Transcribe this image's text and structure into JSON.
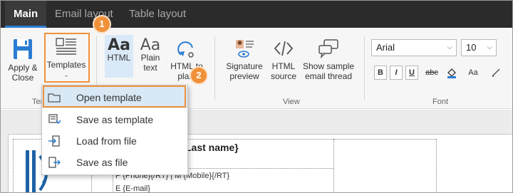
{
  "tabs": [
    {
      "label": "Main",
      "active": true
    },
    {
      "label": "Email layout",
      "active": false
    },
    {
      "label": "Table layout",
      "active": false
    }
  ],
  "ribbon": {
    "apply_close": "Apply & Close",
    "apply_close_l1": "Apply &",
    "apply_close_l2": "Close",
    "templates": "Templates",
    "templates_group_label": "Ten",
    "html_label": "HTML",
    "plain_text_l1": "Plain",
    "plain_text_l2": "text",
    "html_to_plain_l1": "HTML to",
    "html_to_plain_l2": "plain",
    "signature_preview_l1": "Signature",
    "signature_preview_l2": "preview",
    "html_source_l1": "HTML",
    "html_source_l2": "source",
    "show_sample_l1": "Show sample",
    "show_sample_l2": "email thread",
    "view_group_label": "View",
    "font_group_label": "Font",
    "font_family": "Arial",
    "font_size": "10",
    "bold": "B",
    "italic": "I",
    "underline": "U",
    "strike": "abc",
    "case": "Aa",
    "aa_glyph": "Aa"
  },
  "badges": {
    "one": "1",
    "two": "2"
  },
  "menu": {
    "items": [
      {
        "label": "Open template",
        "icon": "folder-icon"
      },
      {
        "label": "Save as template",
        "icon": "save-template-icon"
      },
      {
        "label": "Load from file",
        "icon": "load-file-icon"
      },
      {
        "label": "Save as file",
        "icon": "save-file-icon"
      }
    ]
  },
  "document": {
    "name_field": "Last name}",
    "phone_line": "P {Phone}{/RT} | M {Mobile}{/RT}",
    "email_line": "E {E-mail}"
  },
  "colors": {
    "accent": "#2b7cd3",
    "highlight": "#f0913a",
    "tabbar": "#2b2b2b"
  }
}
